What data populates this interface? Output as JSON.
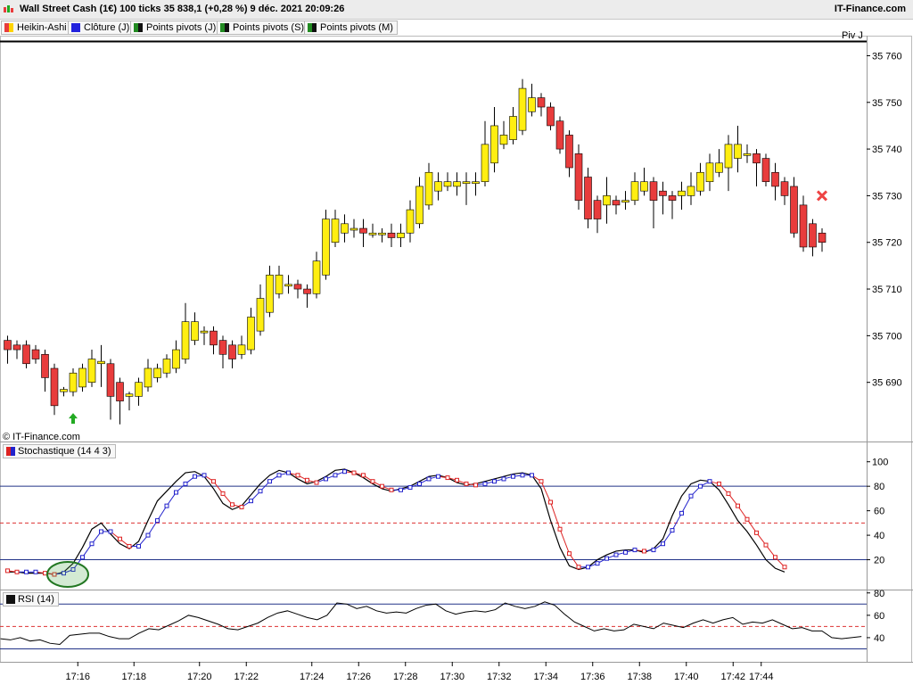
{
  "title": "Wall Street Cash (1€) 100 ticks 35 838,1 (+0,28 %) 9 déc. 2021 20:09:26",
  "brand": "IT-Finance.com",
  "copyright": "© IT-Finance.com",
  "pivot_label": "Piv J",
  "legend": [
    {
      "label": "Heikin-Ashi",
      "color": "#e8a400"
    },
    {
      "label": "Clôture (J)",
      "color": "#2222dd"
    },
    {
      "label": "Points pivots (J)",
      "color": "#228b22"
    },
    {
      "label": "Points pivots (S)",
      "color": "#228b22"
    },
    {
      "label": "Points pivots (M)",
      "color": "#228b22"
    }
  ],
  "colors": {
    "up": "#ffee11",
    "down": "#e83c3c",
    "stoch_k": "#000000",
    "stoch_d_up": "#2222cc",
    "stoch_d_down": "#dd2222",
    "rsi": "#000000",
    "level_line": "#223388",
    "mid_line": "#dd3333",
    "signal_buy": "#22aa22",
    "signal_sell": "#ee4444"
  },
  "chart_data": [
    {
      "type": "candlestick",
      "title": "Heikin-Ashi",
      "ylim": [
        35680,
        35762
      ],
      "yticks": [
        35690,
        35700,
        35710,
        35720,
        35730,
        35740,
        35750,
        35760
      ],
      "ytick_labels": [
        "35 690",
        "35 700",
        "35 710",
        "35 720",
        "35 730",
        "35 740",
        "35 750",
        "35 760"
      ],
      "xtick_labels": [
        "17:16",
        "17:18",
        "17:20",
        "17:22",
        "17:24",
        "17:26",
        "17:28",
        "17:30",
        "17:32",
        "17:34",
        "17:36",
        "17:38",
        "17:40",
        "17:42",
        "17:44"
      ],
      "xtick_index": [
        7.5,
        13.5,
        20.5,
        25.5,
        32.5,
        37.5,
        42.5,
        47.5,
        52.5,
        57.5,
        62.5,
        67.5,
        72.5,
        77.5,
        80.5
      ],
      "candles": [
        {
          "o": 35699,
          "c": 35697,
          "h": 35700,
          "l": 35694
        },
        {
          "o": 35698,
          "c": 35697,
          "h": 35699,
          "l": 35695
        },
        {
          "o": 35698,
          "c": 35694,
          "h": 35699,
          "l": 35693
        },
        {
          "o": 35697,
          "c": 35695,
          "h": 35698,
          "l": 35694
        },
        {
          "o": 35696,
          "c": 35691,
          "h": 35697,
          "l": 35688
        },
        {
          "o": 35693,
          "c": 35685,
          "h": 35694,
          "l": 35683
        },
        {
          "o": 35688,
          "c": 35688.5,
          "h": 35689,
          "l": 35687
        },
        {
          "o": 35688,
          "c": 35692,
          "h": 35693,
          "l": 35687
        },
        {
          "o": 35689,
          "c": 35693,
          "h": 35694,
          "l": 35688
        },
        {
          "o": 35690,
          "c": 35695,
          "h": 35697,
          "l": 35689
        },
        {
          "o": 35694,
          "c": 35694.5,
          "h": 35698,
          "l": 35689
        },
        {
          "o": 35694,
          "c": 35687,
          "h": 35695,
          "l": 35682
        },
        {
          "o": 35690,
          "c": 35686,
          "h": 35691,
          "l": 35681
        },
        {
          "o": 35687,
          "c": 35687.5,
          "h": 35688,
          "l": 35684
        },
        {
          "o": 35687,
          "c": 35690,
          "h": 35691,
          "l": 35685
        },
        {
          "o": 35689,
          "c": 35693,
          "h": 35695,
          "l": 35688
        },
        {
          "o": 35691,
          "c": 35693,
          "h": 35694,
          "l": 35690
        },
        {
          "o": 35692,
          "c": 35695,
          "h": 35696,
          "l": 35691
        },
        {
          "o": 35693,
          "c": 35697,
          "h": 35699,
          "l": 35692
        },
        {
          "o": 35695,
          "c": 35703,
          "h": 35707,
          "l": 35694
        },
        {
          "o": 35699,
          "c": 35703,
          "h": 35705,
          "l": 35698
        },
        {
          "o": 35701,
          "c": 35701,
          "h": 35702,
          "l": 35698
        },
        {
          "o": 35701,
          "c": 35698,
          "h": 35702,
          "l": 35696
        },
        {
          "o": 35699,
          "c": 35696,
          "h": 35700,
          "l": 35693
        },
        {
          "o": 35698,
          "c": 35695,
          "h": 35699,
          "l": 35693
        },
        {
          "o": 35696,
          "c": 35698,
          "h": 35700,
          "l": 35695
        },
        {
          "o": 35697,
          "c": 35704,
          "h": 35706,
          "l": 35696
        },
        {
          "o": 35701,
          "c": 35708,
          "h": 35711,
          "l": 35700
        },
        {
          "o": 35705,
          "c": 35713,
          "h": 35715,
          "l": 35704
        },
        {
          "o": 35709,
          "c": 35713,
          "h": 35715,
          "l": 35708
        },
        {
          "o": 35711,
          "c": 35711,
          "h": 35713,
          "l": 35709
        },
        {
          "o": 35711,
          "c": 35710,
          "h": 35712,
          "l": 35708
        },
        {
          "o": 35710,
          "c": 35709,
          "h": 35711,
          "l": 35706
        },
        {
          "o": 35709,
          "c": 35716,
          "h": 35718,
          "l": 35708
        },
        {
          "o": 35713,
          "c": 35725,
          "h": 35727,
          "l": 35712
        },
        {
          "o": 35720,
          "c": 35725,
          "h": 35727,
          "l": 35719
        },
        {
          "o": 35722,
          "c": 35724,
          "h": 35726,
          "l": 35720
        },
        {
          "o": 35723,
          "c": 35723,
          "h": 35725,
          "l": 35721
        },
        {
          "o": 35723,
          "c": 35722,
          "h": 35725,
          "l": 35719
        },
        {
          "o": 35722,
          "c": 35722,
          "h": 35724,
          "l": 35721
        },
        {
          "o": 35722,
          "c": 35722,
          "h": 35723,
          "l": 35720
        },
        {
          "o": 35722,
          "c": 35721,
          "h": 35724,
          "l": 35719
        },
        {
          "o": 35721,
          "c": 35722,
          "h": 35724,
          "l": 35719
        },
        {
          "o": 35722,
          "c": 35727,
          "h": 35729,
          "l": 35720
        },
        {
          "o": 35724,
          "c": 35732,
          "h": 35734,
          "l": 35723
        },
        {
          "o": 35728,
          "c": 35735,
          "h": 35737,
          "l": 35727
        },
        {
          "o": 35731,
          "c": 35733,
          "h": 35735,
          "l": 35729
        },
        {
          "o": 35732,
          "c": 35733,
          "h": 35735,
          "l": 35731
        },
        {
          "o": 35732,
          "c": 35733,
          "h": 35735,
          "l": 35730
        },
        {
          "o": 35733,
          "c": 35733,
          "h": 35735,
          "l": 35728
        },
        {
          "o": 35733,
          "c": 35733,
          "h": 35735,
          "l": 35730
        },
        {
          "o": 35733,
          "c": 35741,
          "h": 35746,
          "l": 35732
        },
        {
          "o": 35737,
          "c": 35745,
          "h": 35749,
          "l": 35735
        },
        {
          "o": 35741,
          "c": 35743,
          "h": 35746,
          "l": 35740
        },
        {
          "o": 35742,
          "c": 35747,
          "h": 35749,
          "l": 35741
        },
        {
          "o": 35744,
          "c": 35753,
          "h": 35755,
          "l": 35743
        },
        {
          "o": 35748,
          "c": 35751,
          "h": 35754,
          "l": 35747
        },
        {
          "o": 35751,
          "c": 35749,
          "h": 35752,
          "l": 35747
        },
        {
          "o": 35749,
          "c": 35745,
          "h": 35750,
          "l": 35744
        },
        {
          "o": 35746,
          "c": 35740,
          "h": 35747,
          "l": 35739
        },
        {
          "o": 35743,
          "c": 35736,
          "h": 35744,
          "l": 35734
        },
        {
          "o": 35739,
          "c": 35729,
          "h": 35741,
          "l": 35727
        },
        {
          "o": 35734,
          "c": 35725,
          "h": 35736,
          "l": 35723
        },
        {
          "o": 35729,
          "c": 35725,
          "h": 35730,
          "l": 35722
        },
        {
          "o": 35728,
          "c": 35730,
          "h": 35734,
          "l": 35724
        },
        {
          "o": 35729,
          "c": 35728,
          "h": 35730,
          "l": 35726
        },
        {
          "o": 35729,
          "c": 35729,
          "h": 35731,
          "l": 35727
        },
        {
          "o": 35729,
          "c": 35733,
          "h": 35735,
          "l": 35728
        },
        {
          "o": 35731,
          "c": 35733,
          "h": 35736,
          "l": 35730
        },
        {
          "o": 35733,
          "c": 35729,
          "h": 35734,
          "l": 35723
        },
        {
          "o": 35731,
          "c": 35730,
          "h": 35733,
          "l": 35726
        },
        {
          "o": 35730,
          "c": 35729,
          "h": 35731,
          "l": 35725
        },
        {
          "o": 35730,
          "c": 35731,
          "h": 35733,
          "l": 35727
        },
        {
          "o": 35730,
          "c": 35732,
          "h": 35735,
          "l": 35728
        },
        {
          "o": 35731,
          "c": 35735,
          "h": 35737,
          "l": 35730
        },
        {
          "o": 35733,
          "c": 35737,
          "h": 35739,
          "l": 35731
        },
        {
          "o": 35735,
          "c": 35737,
          "h": 35740,
          "l": 35734
        },
        {
          "o": 35736,
          "c": 35741,
          "h": 35743,
          "l": 35731
        },
        {
          "o": 35738,
          "c": 35741,
          "h": 35745,
          "l": 35735
        },
        {
          "o": 35739,
          "c": 35739,
          "h": 35741,
          "l": 35737
        },
        {
          "o": 35739,
          "c": 35737,
          "h": 35740,
          "l": 35732
        },
        {
          "o": 35738,
          "c": 35733,
          "h": 35739,
          "l": 35732
        },
        {
          "o": 35735,
          "c": 35732,
          "h": 35737,
          "l": 35729
        },
        {
          "o": 35733,
          "c": 35730,
          "h": 35734,
          "l": 35728
        },
        {
          "o": 35732,
          "c": 35722,
          "h": 35734,
          "l": 35721
        },
        {
          "o": 35728,
          "c": 35719,
          "h": 35730,
          "l": 35718
        },
        {
          "o": 35724,
          "c": 35719,
          "h": 35725,
          "l": 35717
        },
        {
          "o": 35722,
          "c": 35720,
          "h": 35723,
          "l": 35718
        }
      ],
      "signals": [
        {
          "type": "buy",
          "index": 7,
          "value": 35684
        },
        {
          "type": "sell",
          "index": 87,
          "value": 35730
        }
      ]
    },
    {
      "type": "line",
      "title": "Stochastique (14 4 3)",
      "ylim": [
        0,
        100
      ],
      "yticks": [
        20,
        40,
        60,
        80,
        100
      ],
      "levels": [
        20,
        50,
        80
      ],
      "series": [
        {
          "values": [
            10,
            10,
            9,
            9,
            9,
            8,
            10,
            17,
            30,
            45,
            50,
            41,
            33,
            29,
            35,
            52,
            68,
            76,
            84,
            91,
            92,
            88,
            78,
            66,
            61,
            64,
            73,
            82,
            89,
            93,
            91,
            86,
            82,
            84,
            88,
            93,
            94,
            91,
            87,
            82,
            78,
            76,
            78,
            80,
            84,
            88,
            89,
            87,
            83,
            81,
            82,
            84,
            86,
            88,
            90,
            91,
            89,
            78,
            52,
            30,
            15,
            12,
            14,
            20,
            24,
            27,
            28,
            28,
            26,
            29,
            37,
            56,
            72,
            82,
            85,
            84,
            77,
            65,
            52,
            43,
            32,
            20,
            13,
            10
          ]
        },
        {
          "values": [
            11,
            10,
            10,
            10,
            9,
            8,
            9,
            12,
            22,
            33,
            43,
            43,
            37,
            31,
            31,
            40,
            52,
            64,
            75,
            82,
            88,
            89,
            84,
            74,
            65,
            63,
            68,
            76,
            84,
            89,
            91,
            89,
            85,
            83,
            86,
            89,
            92,
            91,
            89,
            84,
            80,
            77,
            77,
            79,
            82,
            86,
            88,
            87,
            85,
            82,
            81,
            82,
            84,
            86,
            88,
            89,
            89,
            84,
            67,
            45,
            25,
            14,
            14,
            17,
            21,
            24,
            26,
            28,
            27,
            28,
            33,
            44,
            58,
            72,
            80,
            84,
            82,
            74,
            64,
            53,
            42,
            32,
            22,
            14
          ]
        }
      ]
    },
    {
      "type": "line",
      "title": "RSI (14)",
      "ylim": [
        20,
        80
      ],
      "yticks": [
        40,
        60,
        80
      ],
      "levels": [
        30,
        50,
        70
      ],
      "series": [
        {
          "values": [
            39,
            38,
            40,
            37,
            38,
            35,
            34,
            42,
            43,
            44,
            44,
            41,
            39,
            39,
            44,
            48,
            47,
            51,
            55,
            60,
            58,
            55,
            52,
            48,
            47,
            50,
            53,
            58,
            62,
            64,
            61,
            58,
            56,
            60,
            71,
            70,
            66,
            68,
            64,
            62,
            63,
            62,
            66,
            69,
            70,
            64,
            61,
            63,
            64,
            63,
            65,
            71,
            68,
            66,
            68,
            72,
            69,
            61,
            54,
            50,
            46,
            48,
            46,
            47,
            52,
            50,
            48,
            53,
            51,
            49,
            53,
            56,
            53,
            56,
            58,
            52,
            54,
            53,
            56,
            52,
            48,
            49,
            46,
            46,
            40,
            39,
            40,
            41
          ]
        }
      ]
    }
  ]
}
